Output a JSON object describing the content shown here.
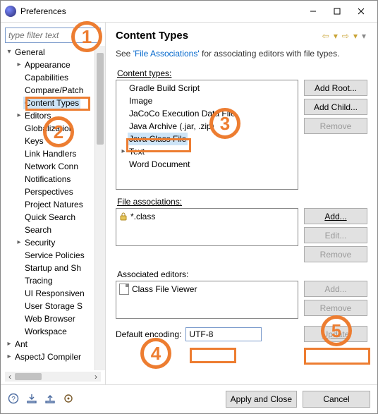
{
  "window": {
    "title": "Preferences"
  },
  "sidebar": {
    "filter_placeholder": "type filter text",
    "tree": {
      "general": {
        "label": "General",
        "items": [
          "Appearance",
          "Capabilities",
          "Compare/Patch",
          "Content Types",
          "Editors",
          "Globalization",
          "Keys",
          "Link Handlers",
          "Network Conn",
          "Notifications",
          "Perspectives",
          "Project Natures",
          "Quick Search",
          "Search",
          "Security",
          "Service Policies",
          "Startup and Sh",
          "Tracing",
          "UI Responsiven",
          "User Storage S",
          "Web Browser",
          "Workspace"
        ],
        "selected_index": 3,
        "expandable_indices": [
          0,
          4,
          14
        ]
      },
      "others": [
        "Ant",
        "AspectJ Compiler"
      ]
    }
  },
  "main": {
    "heading": "Content Types",
    "description_prefix": "See ",
    "description_link": "'File Associations'",
    "description_suffix": " for associating editors with file types.",
    "content_types_label": "Content types:",
    "content_types": [
      {
        "label": "Gradle Build Script",
        "children": false
      },
      {
        "label": "Image",
        "children": false
      },
      {
        "label": "JaCoCo Execution Data File",
        "children": false
      },
      {
        "label": "Java Archive  (.jar, .zip)",
        "children": false
      },
      {
        "label": "Java Class File",
        "children": false,
        "selected": true
      },
      {
        "label": "Text",
        "children": true
      },
      {
        "label": "Word Document",
        "children": false
      }
    ],
    "ct_buttons": {
      "add_root": "Add Root...",
      "add_child": "Add Child...",
      "remove": "Remove"
    },
    "file_assoc_label": "File associations:",
    "file_assoc": [
      {
        "locked": true,
        "pattern": "*.class"
      }
    ],
    "fa_buttons": {
      "add": "Add...",
      "edit": "Edit...",
      "remove": "Remove"
    },
    "ae_label": "Associated editors:",
    "associated_editors": [
      {
        "name": "Class File Viewer"
      }
    ],
    "ae_buttons": {
      "add": "Add...",
      "remove": "Remove"
    },
    "encoding_label": "Default encoding:",
    "encoding_value": "UTF-8",
    "update_label": "Update"
  },
  "footer": {
    "apply_close": "Apply and Close",
    "cancel": "Cancel"
  },
  "annotations": {
    "1": "1",
    "2": "2",
    "3": "3",
    "4": "4",
    "5": "5"
  }
}
